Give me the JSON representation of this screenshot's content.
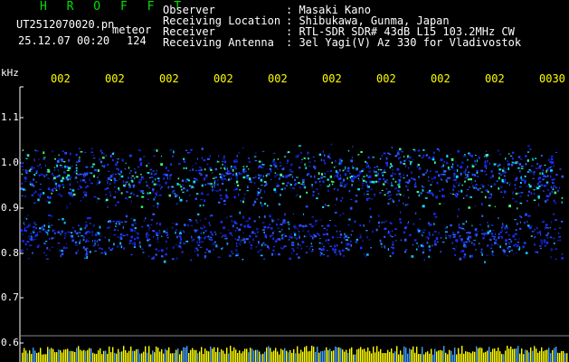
{
  "header": {
    "title": "H R O F F T",
    "filename": "UT2512070020.pn",
    "mode": "meteor",
    "datetime": "25.12.07 00:20",
    "count": "124",
    "fields": [
      {
        "label": "Observer",
        "value": ": Masaki Kano"
      },
      {
        "label": "Receiving Location",
        "value": ": Shibukawa, Gunma, Japan"
      },
      {
        "label": "Receiver",
        "value": ": RTL-SDR SDR# 43dB L15 103.2MHz CW"
      },
      {
        "label": "Receiving Antenna",
        "value": ": 3el Yagi(V) Az 330 for Vladivostok"
      }
    ]
  },
  "axis": {
    "unit": "kHz",
    "y_ticks": [
      "1.1",
      "1.0",
      "0.9",
      "0.8",
      "0.7",
      "0.6"
    ],
    "x_ticks": [
      "002",
      "002",
      "002",
      "002",
      "002",
      "002",
      "002",
      "002",
      "002",
      "0030"
    ]
  },
  "colors": {
    "background": "#000000",
    "title": "#00e000",
    "text": "#ffffff",
    "ticks": "#ffff00",
    "signal": "#2a3cff",
    "bars": "#ffff00"
  }
}
